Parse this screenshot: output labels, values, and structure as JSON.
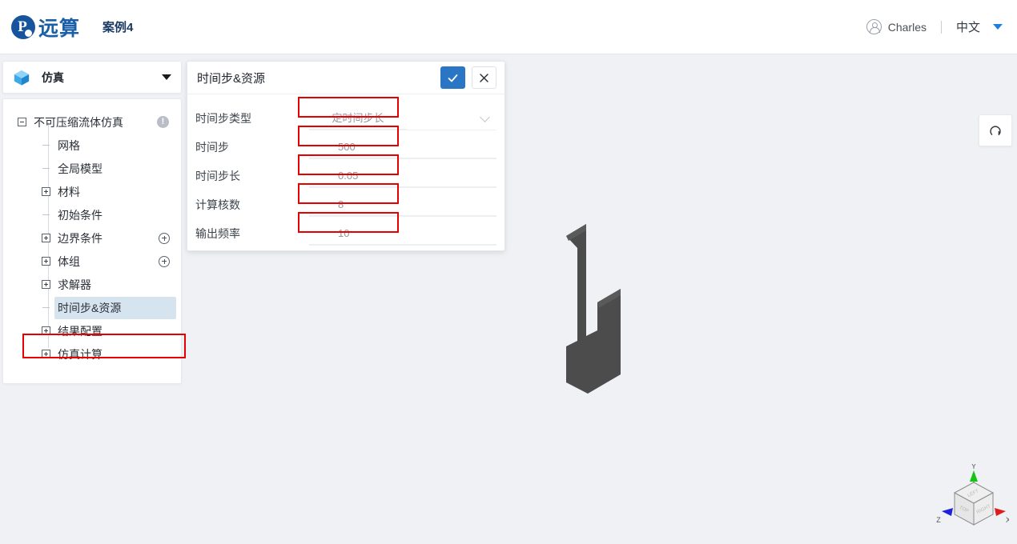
{
  "header": {
    "logo_text": "远算",
    "logo_glyph": "P",
    "project_title": "案例4",
    "user_name": "Charles",
    "language": "中文",
    "avatar_icon": "user-circle-icon",
    "caret_icon": "caret-down-icon"
  },
  "sidebar": {
    "header": {
      "label": "仿真",
      "icon": "cube-icon",
      "caret": "caret-down-icon"
    },
    "tree": [
      {
        "label": "不可压缩流体仿真",
        "toggle": "minus-box",
        "level": 0,
        "badge": "!"
      },
      {
        "label": "网格",
        "toggle": "dash",
        "level": 1
      },
      {
        "label": "全局模型",
        "toggle": "dash",
        "level": 1
      },
      {
        "label": "材料",
        "toggle": "plus-box",
        "level": 1
      },
      {
        "label": "初始条件",
        "toggle": "dash",
        "level": 1
      },
      {
        "label": "边界条件",
        "toggle": "plus-box",
        "level": 1,
        "add": true
      },
      {
        "label": "体组",
        "toggle": "plus-box",
        "level": 1,
        "add": true
      },
      {
        "label": "求解器",
        "toggle": "plus-box",
        "level": 1
      },
      {
        "label": "时间步&资源",
        "toggle": "dash",
        "level": 1,
        "selected": true
      },
      {
        "label": "结果配置",
        "toggle": "plus-box",
        "level": 1
      },
      {
        "label": "仿真计算",
        "toggle": "plus-box",
        "level": 1
      }
    ]
  },
  "dialog": {
    "title": "时间步&资源",
    "confirm_icon": "check-icon",
    "close_icon": "close-icon",
    "fields": [
      {
        "label": "时间步类型",
        "value": "定时间步长",
        "type": "select",
        "highlight": true
      },
      {
        "label": "时间步",
        "value": "500",
        "type": "text",
        "highlight": true
      },
      {
        "label": "时间步长",
        "value": "0.05",
        "type": "text",
        "highlight": true
      },
      {
        "label": "计算核数",
        "value": "8",
        "type": "text",
        "highlight": true
      },
      {
        "label": "输出频率",
        "value": "10",
        "type": "text",
        "highlight": true
      }
    ]
  },
  "viewport": {
    "reset_icon": "reset-view-icon",
    "axis_gizmo": {
      "axes": [
        {
          "name": "Y",
          "color": "#15c415"
        },
        {
          "name": "X",
          "color": "#e01b1b"
        },
        {
          "name": "Z",
          "color": "#1f1fdd"
        }
      ],
      "faces": [
        "LEFT",
        "TOP",
        "RIGHT"
      ]
    },
    "model_color": "#4c4c4c"
  },
  "colors": {
    "accent": "#2a76c4",
    "brand": "#16559e",
    "annotation": "#e60000",
    "background": "#eff1f5",
    "selection": "#d6e4f0"
  }
}
